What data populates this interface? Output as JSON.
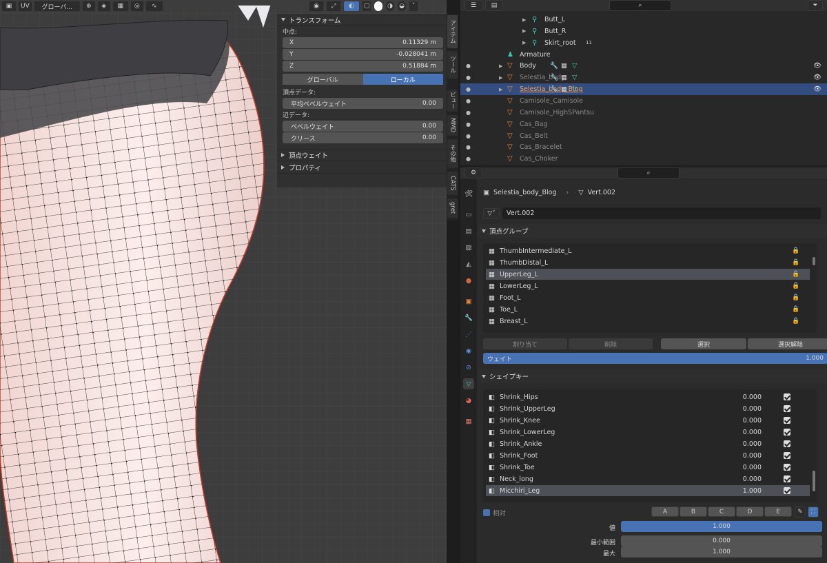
{
  "viewport_header": {
    "uv_label": "UV",
    "transform_orientation": "グローバ...",
    "icons": [
      "select-icon",
      "orientation-icon",
      "snap-icon",
      "grid-icon",
      "proportional-icon",
      "falloff-icon",
      "visibility-icon",
      "gizmo-icon",
      "overlay-icon",
      "xray-icon",
      "shading-solid-icon",
      "shading-material-icon",
      "shading-render-icon"
    ]
  },
  "npanel": {
    "transform_header": "トランスフォーム",
    "median_label": "中点:",
    "x_label": "X",
    "x_value": "0.11329 m",
    "y_label": "Y",
    "y_value": "-0.028041 m",
    "z_label": "Z",
    "z_value": "0.51884 m",
    "global_label": "グローバル",
    "local_label": "ローカル",
    "vertex_data_label": "頂点データ:",
    "mean_bevel_label": "平均ベベルウェイト",
    "mean_bevel_value": "0.00",
    "edge_data_label": "辺データ:",
    "bevel_weight_label": "ベベルウェイト",
    "bevel_weight_value": "0.00",
    "crease_label": "クリース",
    "crease_value": "0.00",
    "vertex_weights_header": "頂点ウェイト",
    "properties_header": "プロパティ"
  },
  "vtabs": [
    "アイテム",
    "ツール",
    "ビュー",
    "MMD",
    "その他",
    "CATS",
    "gret"
  ],
  "outliner": {
    "rows": [
      {
        "label": "Butt_L",
        "type": "bone",
        "style": "normal"
      },
      {
        "label": "Butt_R",
        "type": "bone",
        "style": "normal"
      },
      {
        "label": "Skirt_root",
        "type": "bone",
        "style": "normal",
        "badge": "11"
      },
      {
        "label": "Armature",
        "type": "armature",
        "style": "normal"
      },
      {
        "label": "Body",
        "type": "mesh",
        "style": "normal"
      },
      {
        "label": "Selestia_body",
        "type": "mesh",
        "style": "dim"
      },
      {
        "label": "Selestia_body_Blog",
        "type": "mesh",
        "style": "orange"
      },
      {
        "label": "Camisole_Camisole",
        "type": "mesh",
        "style": "dim"
      },
      {
        "label": "Camisole_HighSPantsu",
        "type": "mesh",
        "style": "dim"
      },
      {
        "label": "Cas_Bag",
        "type": "mesh",
        "style": "dim"
      },
      {
        "label": "Cas_Belt",
        "type": "mesh",
        "style": "dim"
      },
      {
        "label": "Cas_Bracelet",
        "type": "mesh",
        "style": "dim"
      },
      {
        "label": "Cas_Choker",
        "type": "mesh",
        "style": "dim"
      }
    ]
  },
  "properties": {
    "breadcrumb_object": "Selestia_body_Blog",
    "breadcrumb_data": "Vert.002",
    "mesh_name": "Vert.002",
    "vertex_groups_header": "頂点グループ",
    "vertex_groups": [
      "ThumbIntermediate_L",
      "ThumbDistal_L",
      "UpperLeg_L",
      "LowerLeg_L",
      "Foot_L",
      "Toe_L",
      "Breast_L"
    ],
    "vg_selected": "UpperLeg_L",
    "assign_label": "割り当て",
    "remove_label": "削除",
    "select_label": "選択",
    "deselect_label": "選択解除",
    "weight_label": "ウェイト",
    "weight_value": "1.000",
    "shape_keys_header": "シェイプキー",
    "shape_keys": [
      {
        "name": "Shrink_Hips",
        "value": "0.000"
      },
      {
        "name": "Shrink_UpperLeg",
        "value": "0.000"
      },
      {
        "name": "Shrink_Knee",
        "value": "0.000"
      },
      {
        "name": "Shrink_LowerLeg",
        "value": "0.000"
      },
      {
        "name": "Shrink_Ankle",
        "value": "0.000"
      },
      {
        "name": "Shrink_Foot",
        "value": "0.000"
      },
      {
        "name": "Shrink_Toe",
        "value": "0.000"
      },
      {
        "name": "Neck_long",
        "value": "0.000"
      },
      {
        "name": "Micchiri_Leg",
        "value": "1.000"
      }
    ],
    "sk_selected": "Micchiri_Leg",
    "relative_label": "相対",
    "abcde": [
      "A",
      "B",
      "C",
      "D",
      "E"
    ],
    "value_label": "値",
    "value_value": "1.000",
    "min_label": "最小範囲",
    "min_value": "0.000",
    "max_label": "最大",
    "max_value": "1.000"
  },
  "colors": {
    "accent": "#4772b3",
    "selected_row": "#334d80",
    "mesh_orange": "#f0a15a",
    "bone_teal": "#3fc7b5",
    "skin": "#f7e3e0"
  }
}
